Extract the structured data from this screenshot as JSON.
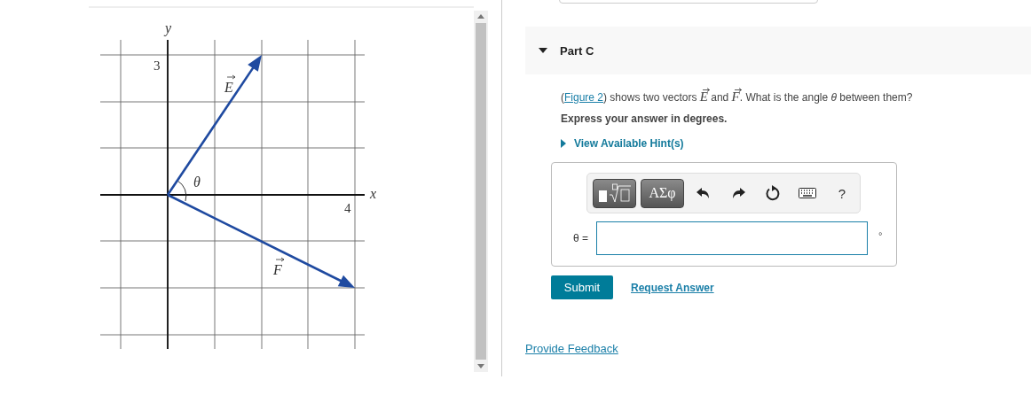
{
  "figure": {
    "axis_labels": {
      "x": "x",
      "y": "y"
    },
    "tick_labels": [
      "3",
      "4"
    ],
    "angle_label": "θ",
    "vectors": [
      {
        "name": "E"
      },
      {
        "name": "F"
      }
    ]
  },
  "part": {
    "title": "Part C",
    "expanded": true
  },
  "question": [
    {
      "kind": "text",
      "text": "("
    },
    {
      "kind": "link",
      "text": "Figure 2"
    },
    {
      "kind": "text",
      "text": ") shows two vectors "
    },
    {
      "kind": "vector",
      "text": "E"
    },
    {
      "kind": "text",
      "text": " and "
    },
    {
      "kind": "vector",
      "text": "F"
    },
    {
      "kind": "text",
      "text": ". What is the angle *θ* between them?"
    }
  ],
  "instruction": "Express your answer in degrees.",
  "hints": {
    "label": "View Available Hint(s)",
    "expanded": false
  },
  "toolbar": [
    {
      "kind": "templates"
    },
    {
      "kind": "symbols",
      "label": "ΑΣφ"
    },
    {
      "kind": "undo"
    },
    {
      "kind": "redo"
    },
    {
      "kind": "reset"
    },
    {
      "kind": "keyboard"
    },
    {
      "kind": "help",
      "label": "?"
    }
  ],
  "answer": {
    "label": "θ =",
    "unit": "°"
  },
  "buttons": {
    "submit": "Submit",
    "request": "Request Answer"
  },
  "feedback_link": "Provide Feedback"
}
